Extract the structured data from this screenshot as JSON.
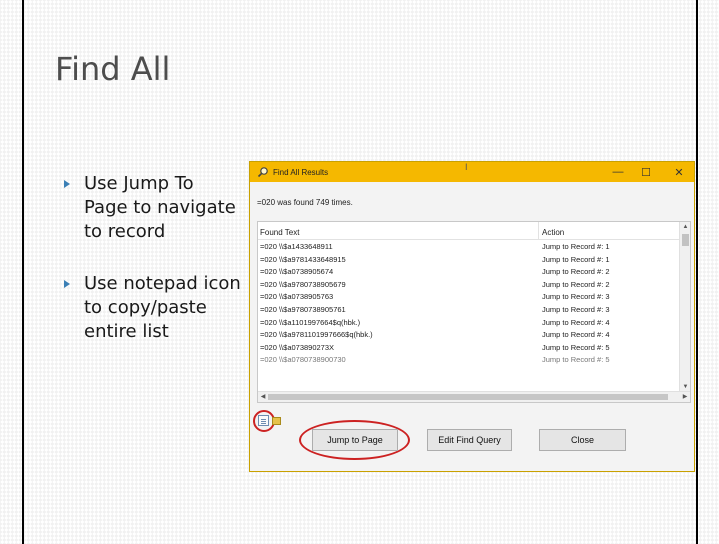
{
  "slide": {
    "title": "Find All",
    "bullets": [
      "Use Jump To Page to navigate to record",
      "Use notepad icon to copy/paste entire list"
    ]
  },
  "dialog": {
    "title": "Find All Results",
    "title_mark": "I",
    "controls": {
      "minimize": "—",
      "maximize": "☐",
      "close": "✕"
    },
    "status": "=020 was found 749 times.",
    "columns": [
      "Found Text",
      "Action"
    ],
    "rows": [
      [
        "=020  \\\\$a1433648911",
        "Jump to Record #: 1"
      ],
      [
        "=020  \\\\$a9781433648915",
        "Jump to Record #: 1"
      ],
      [
        "=020  \\\\$a0738905674",
        "Jump to Record #: 2"
      ],
      [
        "=020  \\\\$a9780738905679",
        "Jump to Record #: 2"
      ],
      [
        "=020  \\\\$a0738905763",
        "Jump to Record #: 3"
      ],
      [
        "=020  \\\\$a9780738905761",
        "Jump to Record #: 3"
      ],
      [
        "=020  \\\\$a1101997664$q(hbk.)",
        "Jump to Record #: 4"
      ],
      [
        "=020  \\\\$a9781101997666$q(hbk.)",
        "Jump to Record #: 4"
      ],
      [
        "=020  \\\\$a073890273X",
        "Jump to Record #: 5"
      ],
      [
        "=020  \\\\$a0780738900730",
        "Jump to Record #: 5"
      ]
    ],
    "buttons": {
      "jump": "Jump to Page",
      "edit": "Edit Find Query",
      "close": "Close"
    },
    "colors": {
      "titlebar": "#f5b800",
      "highlight": "#cc2222"
    }
  }
}
